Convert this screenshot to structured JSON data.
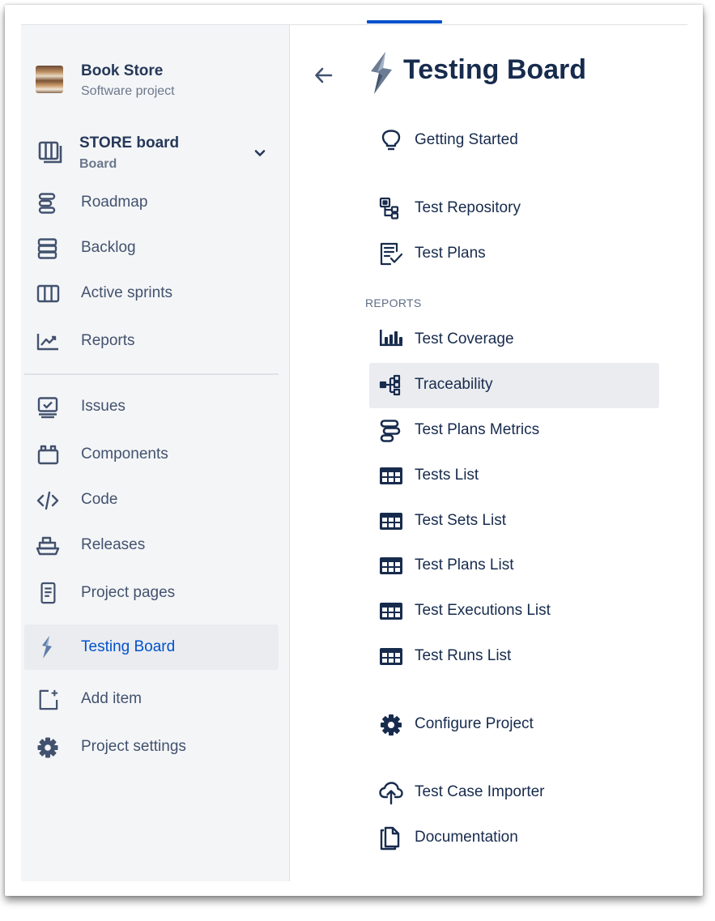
{
  "project": {
    "name": "Book Store",
    "type": "Software project"
  },
  "board": {
    "name": "STORE board",
    "subtitle": "Board"
  },
  "sidebar": {
    "planning_items": [
      {
        "label": "Roadmap",
        "icon": "roadmap-icon"
      },
      {
        "label": "Backlog",
        "icon": "backlog-icon"
      },
      {
        "label": "Active sprints",
        "icon": "active-sprints-icon"
      },
      {
        "label": "Reports",
        "icon": "reports-icon"
      }
    ],
    "dev_items": [
      {
        "label": "Issues",
        "icon": "issues-icon"
      },
      {
        "label": "Components",
        "icon": "components-icon"
      },
      {
        "label": "Code",
        "icon": "code-icon"
      },
      {
        "label": "Releases",
        "icon": "releases-icon"
      },
      {
        "label": "Project pages",
        "icon": "project-pages-icon"
      },
      {
        "label": "Testing Board",
        "icon": "testing-board-icon",
        "active": true
      },
      {
        "label": "Add item",
        "icon": "add-item-icon"
      },
      {
        "label": "Project settings",
        "icon": "gear-icon"
      }
    ]
  },
  "panel": {
    "title": "Testing Board",
    "back_icon": "arrow-left-icon",
    "items": [
      {
        "label": "Getting Started",
        "icon": "lightbulb-icon"
      },
      {
        "label": "Test Repository",
        "icon": "test-repository-icon"
      },
      {
        "label": "Test Plans",
        "icon": "test-plans-icon"
      }
    ],
    "reports_heading": "REPORTS",
    "report_items": [
      {
        "label": "Test Coverage",
        "icon": "bar-chart-icon"
      },
      {
        "label": "Traceability",
        "icon": "traceability-icon",
        "selected": true
      },
      {
        "label": "Test Plans Metrics",
        "icon": "metrics-icon"
      },
      {
        "label": "Tests List",
        "icon": "table-icon"
      },
      {
        "label": "Test Sets List",
        "icon": "table-icon"
      },
      {
        "label": "Test Plans List",
        "icon": "table-icon"
      },
      {
        "label": "Test Executions List",
        "icon": "table-icon"
      },
      {
        "label": "Test Runs List",
        "icon": "table-icon"
      }
    ],
    "configure_label": "Configure Project",
    "importer_label": "Test Case Importer",
    "documentation_label": "Documentation"
  },
  "colors": {
    "accent": "#0052cc",
    "active_bg": "#ebecf0",
    "sidebar_bg": "#f4f5f7",
    "text": "#172b4d",
    "muted": "#6b778c"
  }
}
